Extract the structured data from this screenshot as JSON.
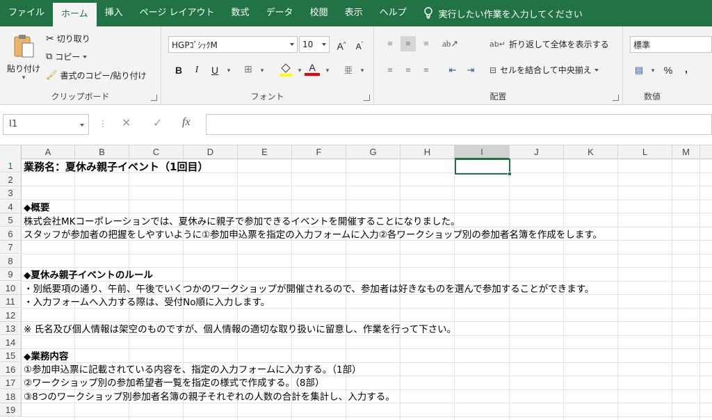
{
  "ribbon_tabs": [
    "ファイル",
    "ホーム",
    "挿入",
    "ページ レイアウト",
    "数式",
    "データ",
    "校閲",
    "表示",
    "ヘルプ"
  ],
  "active_tab": "ホーム",
  "tell_me": "実行したい作業を入力してください",
  "clipboard": {
    "paste": "貼り付け",
    "cut": "切り取り",
    "copy": "コピー",
    "format_painter": "書式のコピー/貼り付け",
    "label": "クリップボード"
  },
  "font": {
    "name": "HGPｺﾞｼｯｸM",
    "size": "10",
    "label": "フォント"
  },
  "alignment": {
    "wrap": "折り返して全体を表示する",
    "merge": "セルを結合して中央揃え",
    "label": "配置"
  },
  "number": {
    "format": "標準",
    "percent": "%",
    "comma": ",",
    "label": "数値"
  },
  "formula_bar": {
    "name_box": "I1",
    "fx": "fx",
    "content": ""
  },
  "columns": [
    "A",
    "B",
    "C",
    "D",
    "E",
    "F",
    "G",
    "H",
    "I",
    "J",
    "K",
    "L",
    "M"
  ],
  "selected_column": "I",
  "rows": [
    "1",
    "2",
    "3",
    "4",
    "5",
    "6",
    "7",
    "8",
    "9",
    "10",
    "11",
    "12",
    "13",
    "14",
    "15",
    "16",
    "17",
    "18",
    "19"
  ],
  "cells": {
    "r1": "業務名：夏休み親子イベント（1回目）",
    "r4": "◆概要",
    "r5": "株式会社MKコーポレーションでは、夏休みに親子で参加できるイベントを開催することになりました。",
    "r6": "スタッフが参加者の把握をしやすいように①参加申込票を指定の入力フォームに入力②各ワークショップ別の参加者名簿を作成をします。",
    "r9": "◆夏休み親子イベントのルール",
    "r10": "・別紙要項の通り、午前、午後でいくつかのワークショップが開催されるので、参加者は好きなものを選んで参加することができます。",
    "r11": "・入力フォームへ入力する際は、受付No順に入力します。",
    "r13": "※ 氏名及び個人情報は架空のものですが、個人情報の適切な取り扱いに留意し、作業を行って下さい。",
    "r15": "◆業務内容",
    "r16": "①参加申込票に記載されている内容を、指定の入力フォームに入力する。（1部）",
    "r17": "②ワークショップ別の参加希望者一覧を指定の様式で作成する。（8部）",
    "r18": "③8つのワークショップ別参加者名簿の親子それぞれの人数の合計を集計し、入力する。"
  },
  "colors": {
    "excel_green": "#217346",
    "ribbon_bg": "#f3f3f3"
  }
}
